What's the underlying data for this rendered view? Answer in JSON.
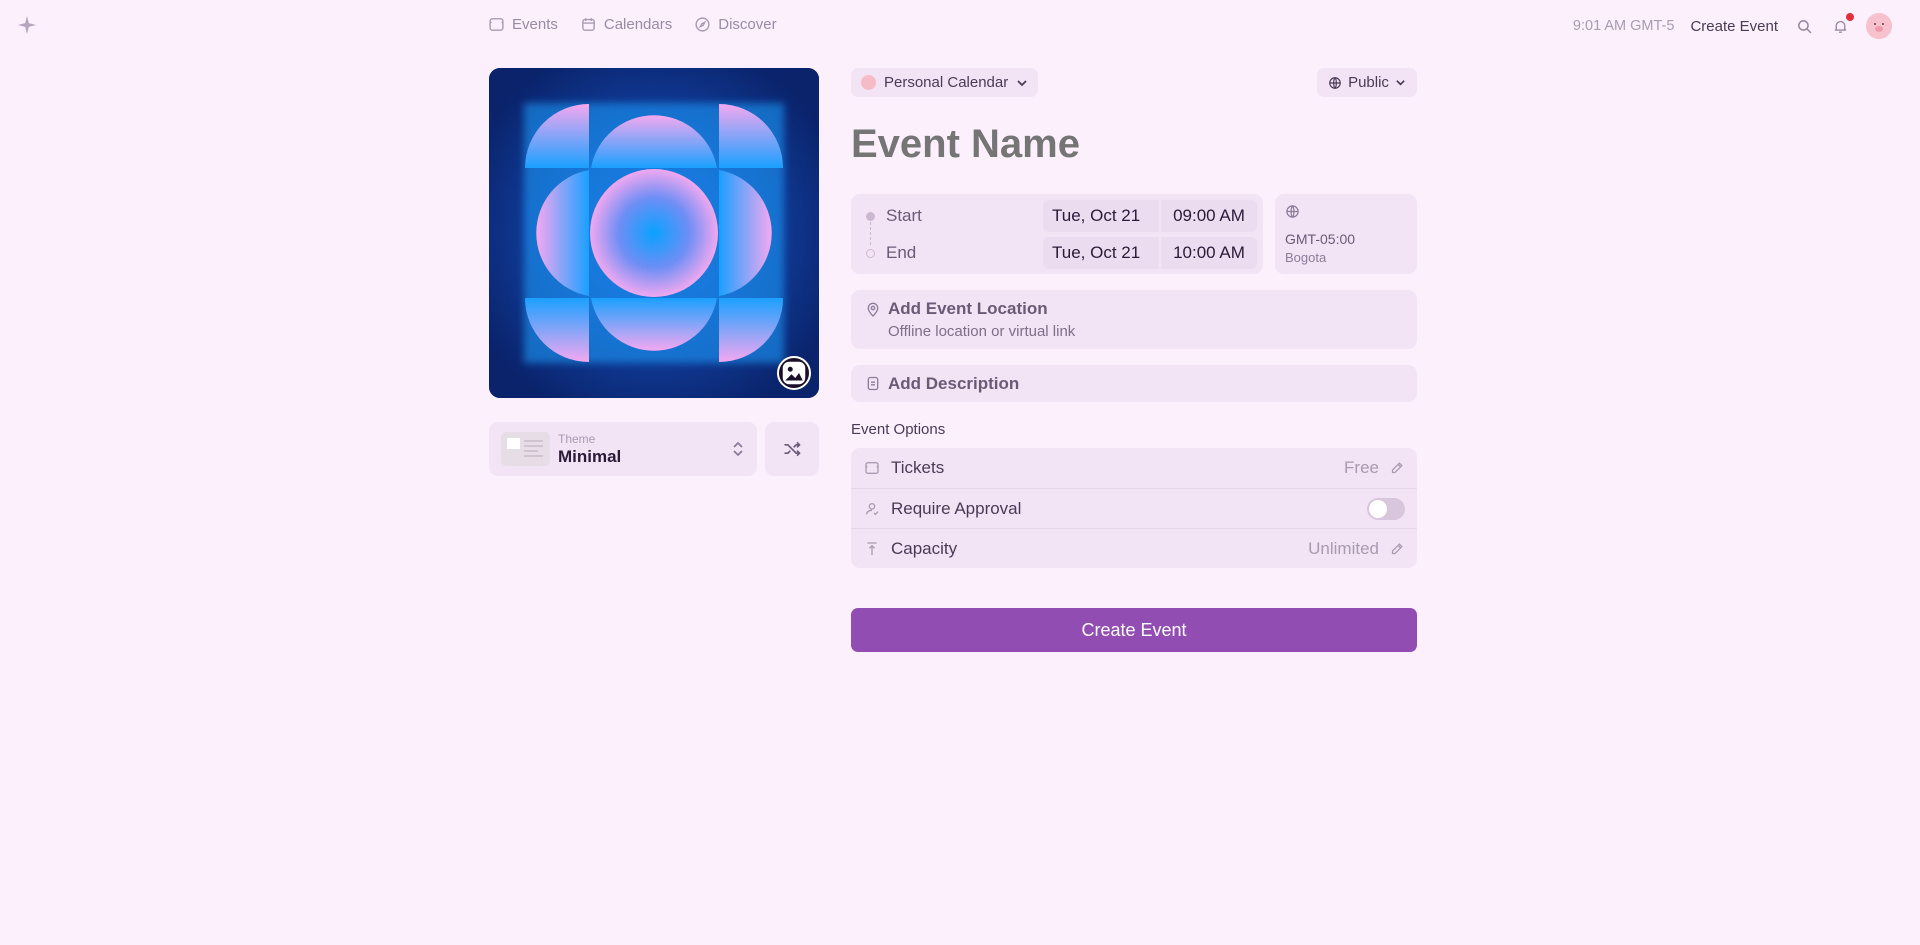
{
  "nav": {
    "logo_icon": "sparkle-icon",
    "items": [
      {
        "label": "Events",
        "icon": "ticket-icon"
      },
      {
        "label": "Calendars",
        "icon": "calendar-icon"
      },
      {
        "label": "Discover",
        "icon": "compass-icon"
      }
    ],
    "clock": "9:01 AM GMT-5",
    "create_event_label": "Create Event"
  },
  "cover": {
    "edit_icon": "image-icon"
  },
  "theme": {
    "label": "Theme",
    "value": "Minimal"
  },
  "calendar_select": {
    "label": "Personal Calendar"
  },
  "visibility": {
    "label": "Public"
  },
  "event_name": {
    "placeholder": "Event Name"
  },
  "datetime": {
    "start_label": "Start",
    "end_label": "End",
    "start_date": "Tue, Oct 21",
    "start_time": "09:00 AM",
    "end_date": "Tue, Oct 21",
    "end_time": "10:00 AM"
  },
  "timezone": {
    "offset": "GMT-05:00",
    "city": "Bogota"
  },
  "location": {
    "title": "Add Event Location",
    "subtitle": "Offline location or virtual link"
  },
  "description": {
    "title": "Add Description"
  },
  "options": {
    "heading": "Event Options",
    "tickets_label": "Tickets",
    "tickets_value": "Free",
    "approval_label": "Require Approval",
    "approval_enabled": false,
    "capacity_label": "Capacity",
    "capacity_value": "Unlimited"
  },
  "submit": {
    "label": "Create Event"
  },
  "colors": {
    "background": "#fcf0fd",
    "card": "#f3e4f5",
    "accent": "#924db3",
    "notification": "#e0313a"
  }
}
